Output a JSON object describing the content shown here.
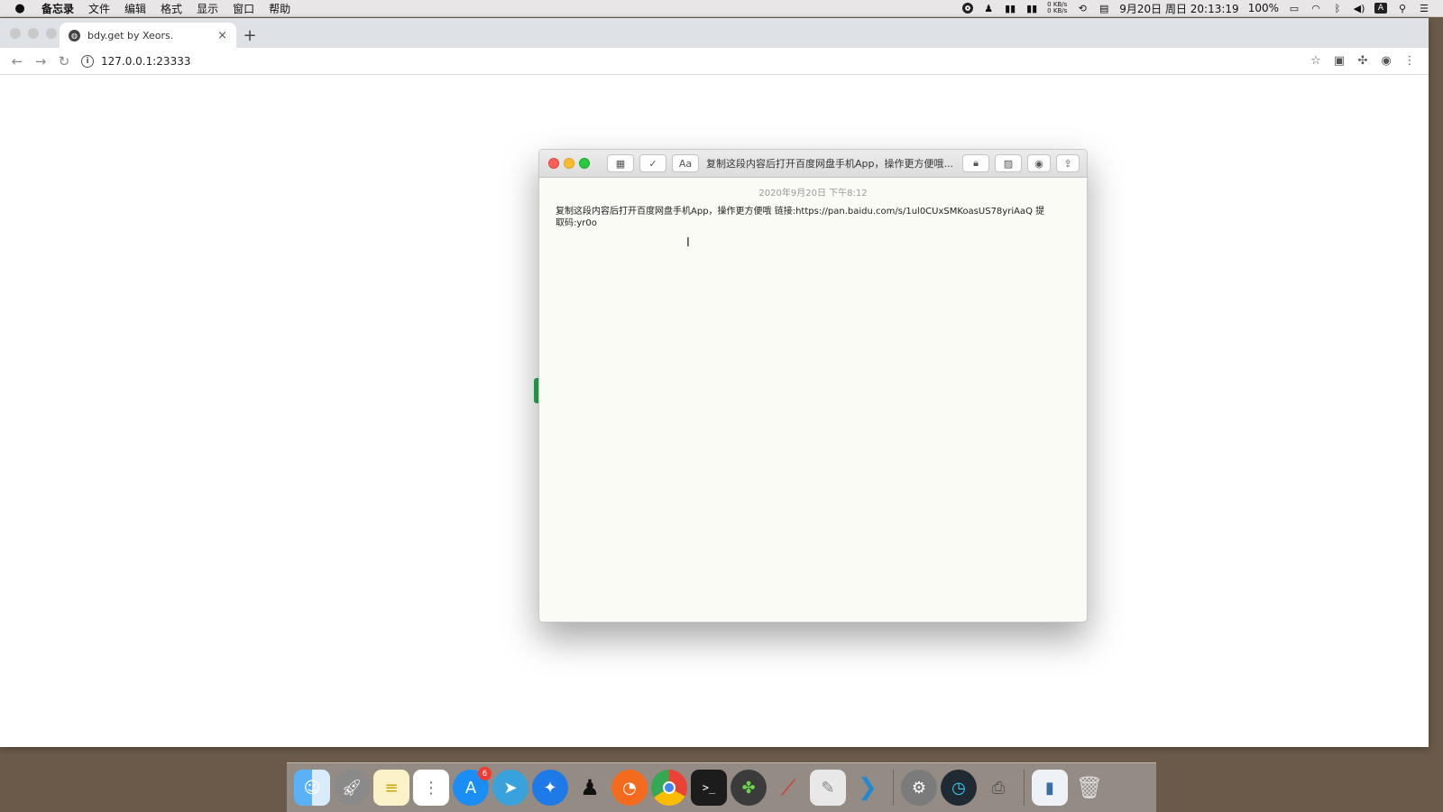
{
  "menubar": {
    "app_name": "备忘录",
    "items": [
      "文件",
      "编辑",
      "格式",
      "显示",
      "窗口",
      "帮助"
    ],
    "net_up": "0 KB/s",
    "net_down": "0 KB/s",
    "datetime": "9月20日 周日  20:13:19",
    "battery": "100%",
    "input_method": "A"
  },
  "browser": {
    "tab_title": "bdy.get by Xeors.",
    "tab_close": "×",
    "new_tab": "+",
    "url": "127.0.0.1:23333"
  },
  "notes": {
    "title": "复制这段内容后打开百度网盘手机App，操作更方便哦...",
    "date": "2020年9月20日 下午8:12",
    "body": "复制这段内容后打开百度网盘手机App，操作更方便哦 链接:https://pan.baidu.com/s/1ul0CUxSMKoasUS78yriAaQ 提取码:yr0o",
    "format_button": "Aa"
  },
  "dock": {
    "appstore_badge": "6",
    "apps": [
      "finder",
      "launchpad",
      "notes",
      "reminders",
      "app-store",
      "telegram",
      "safari",
      "qq",
      "firefox",
      "chrome",
      "terminal",
      "clover",
      "redis",
      "script-editor",
      "vscode",
      "system-preferences",
      "istat",
      "printer",
      "archive",
      "trash"
    ]
  }
}
